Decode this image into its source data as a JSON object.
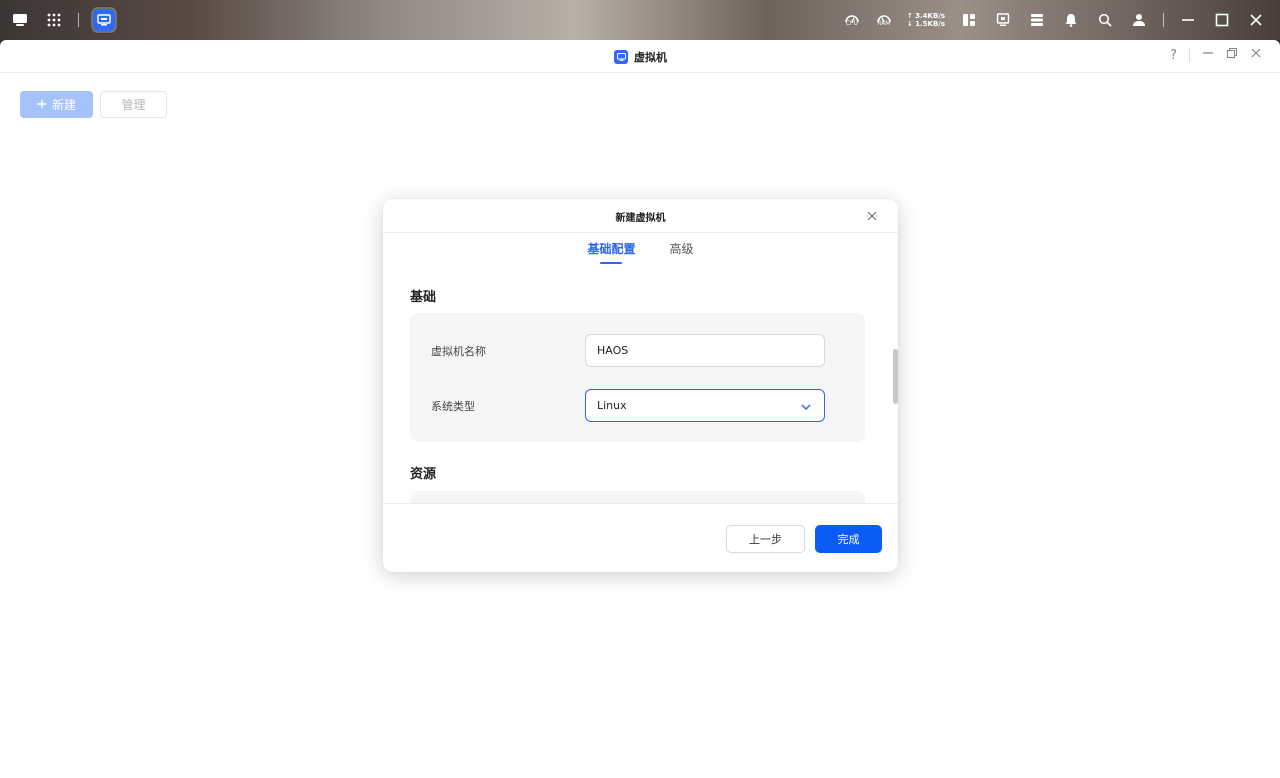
{
  "system_bar": {
    "left_icons": [
      "desktop-icon",
      "apps-grid-icon",
      "virtual-machine-icon"
    ],
    "cpu_label": "CPU",
    "ram_label": "RAM",
    "upload_speed": "↑ 3.4KB/s",
    "download_speed": "↓ 1.5KB/s",
    "right_icons": [
      "widgets-icon",
      "monitor-icon",
      "tasks-icon",
      "notification-bell-icon",
      "search-icon",
      "user-icon",
      "minimize-icon",
      "maximize-icon",
      "close-icon"
    ]
  },
  "window": {
    "title": "虚拟机",
    "help_label": "?",
    "toolbar": {
      "new_label": "新建",
      "manage_label": "管理"
    }
  },
  "dialog": {
    "title": "新建虚拟机",
    "tabs": [
      {
        "label": "基础配置",
        "active": true
      },
      {
        "label": "高级",
        "active": false
      }
    ],
    "sections": {
      "basic": {
        "title": "基础",
        "fields": {
          "name_label": "虚拟机名称",
          "name_value": "HAOS",
          "os_type_label": "系统类型",
          "os_type_value": "Linux"
        }
      },
      "resources": {
        "title": "资源"
      }
    },
    "footer": {
      "prev_label": "上一步",
      "done_label": "完成"
    }
  },
  "colors": {
    "accent": "#2b65f0",
    "primary_button": "#0b5cf5",
    "disabled_button": "#a6c2fb"
  }
}
